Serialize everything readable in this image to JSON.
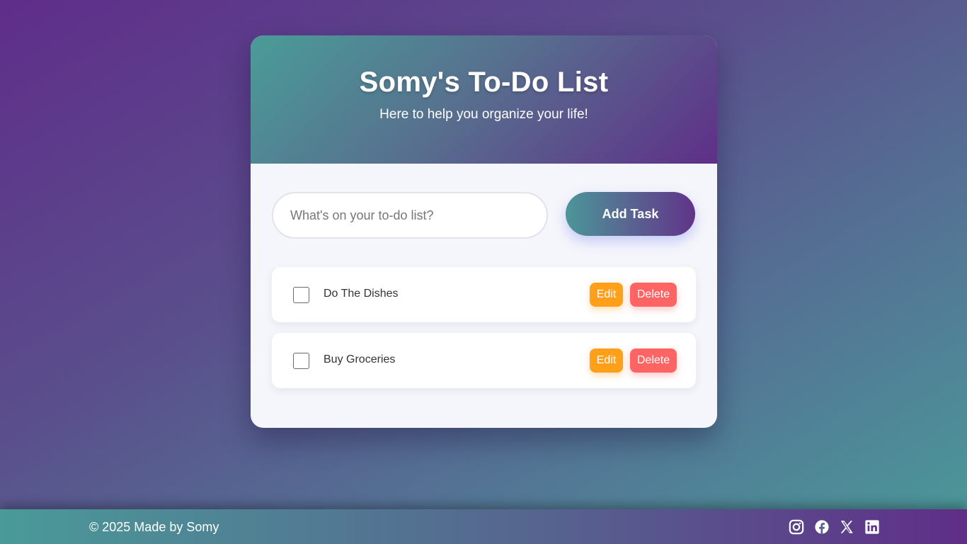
{
  "header": {
    "title": "Somy's To-Do List",
    "subtitle": "Here to help you organize your life!"
  },
  "input": {
    "placeholder": "What's on your to-do list?",
    "value": ""
  },
  "add_button": {
    "label": "Add Task"
  },
  "tasks": [
    {
      "label": "Do The Dishes",
      "checked": false,
      "edit_label": "Edit",
      "delete_label": "Delete"
    },
    {
      "label": "Buy Groceries",
      "checked": false,
      "edit_label": "Edit",
      "delete_label": "Delete"
    }
  ],
  "footer": {
    "copyright": "© 2025 Made by Somy",
    "socials": [
      "instagram-icon",
      "facebook-icon",
      "x-icon",
      "linkedin-icon"
    ]
  },
  "colors": {
    "edit": "#ff9f1a",
    "delete": "#ff6464",
    "accent_teal": "#4a9a99",
    "accent_purple": "#5f2e88"
  }
}
